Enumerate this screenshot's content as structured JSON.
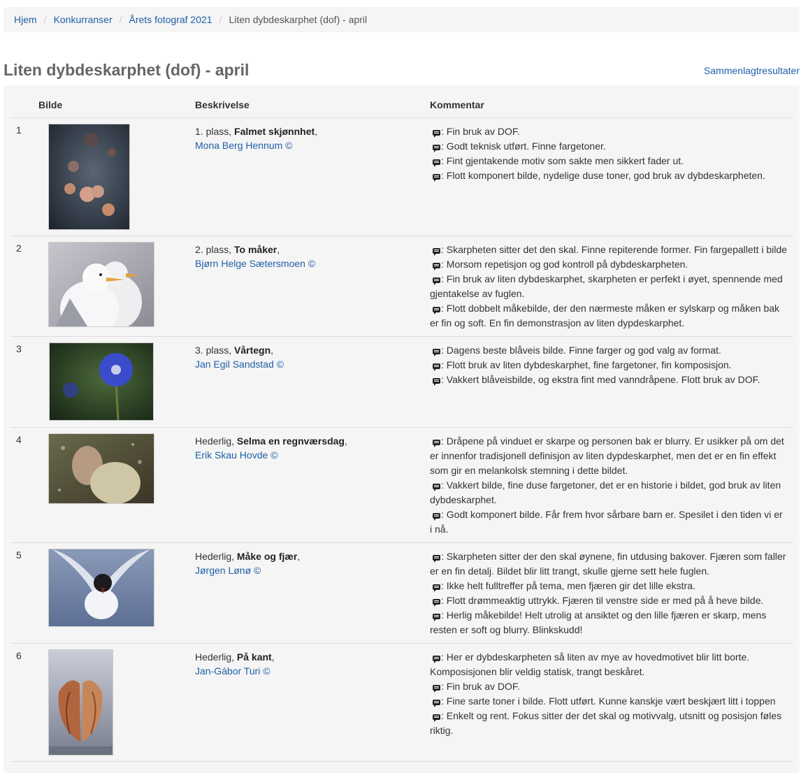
{
  "breadcrumb": {
    "items": [
      "Hjem",
      "Konkurranser",
      "Årets fotograf 2021"
    ],
    "current": "Liten dybdeskarphet (dof) - april"
  },
  "page": {
    "title": "Liten dybdeskarphet (dof) - april",
    "summary_link": "Sammenlagtresultater"
  },
  "table": {
    "headers": {
      "image": "Bilde",
      "description": "Beskrivelse",
      "comment": "Kommentar"
    },
    "rows": [
      {
        "num": "1",
        "placement": "1. plass,",
        "title": "Falmet skjønnhet",
        "author": "Mona Berg Hennum ©",
        "comments": [
          ": Fin bruk av DOF.",
          ": Godt teknisk utført. Finne fargetoner.",
          ": Fint gjentakende motiv som sakte men sikkert fader ut.",
          ": Flott komponert bilde, nydelige duse toner, god bruk av dybdeskarpheten."
        ]
      },
      {
        "num": "2",
        "placement": "2. plass,",
        "title": "To måker",
        "author": "Bjørn Helge Sætersmoen ©",
        "comments": [
          ": Skarpheten sitter det den skal. Finne repiterende former. Fin fargepallett i bilde",
          ": Morsom repetisjon og god kontroll på dybdeskarpheten.",
          ": Fin bruk av liten dybdeskarphet, skarpheten er perfekt i øyet, spennende med gjentakelse av fuglen.",
          ": Flott dobbelt måkebilde, der den nærmeste måken er sylskarp og måken bak er fin og soft. En fin demonstrasjon av liten dypdeskarphet."
        ]
      },
      {
        "num": "3",
        "placement": "3. plass,",
        "title": "Vårtegn",
        "author": "Jan Egil Sandstad ©",
        "comments": [
          ": Dagens beste blåveis bilde. Finne farger og god valg av format.",
          ": Flott bruk av liten dybdeskarphet, fine fargetoner, fin komposisjon.",
          ": Vakkert blåveisbilde, og ekstra fint med vanndråpene. Flott bruk av DOF."
        ]
      },
      {
        "num": "4",
        "placement": "Hederlig,",
        "title": "Selma en regnværsdag",
        "author": "Erik Skau Hovde ©",
        "comments": [
          ": Dråpene på vinduet er skarpe og personen bak er blurry. Er usikker på om det er innenfor tradisjonell definisjon av liten dypdeskarphet, men det er en fin effekt som gir en melankolsk stemning i dette bildet.",
          ": Vakkert bilde, fine duse fargetoner, det er en historie i bildet, god bruk av liten dybdeskarphet.",
          ": Godt komponert bilde. Får frem hvor sårbare barn er. Spesilet i den tiden vi er i nå."
        ]
      },
      {
        "num": "5",
        "placement": "Hederlig,",
        "title": "Måke og fjær",
        "author": "Jørgen Lønø ©",
        "comments": [
          ": Skarpheten sitter der den skal øynene, fin utdusing bakover. Fjæren som faller er en fin detalj. Bildet blir litt trangt, skulle gjerne sett hele fuglen.",
          ": Ikke helt fulltreffer på tema, men fjæren gir det lille ekstra.",
          ": Flott drømmeaktig uttrykk. Fjæren til venstre side er med på å heve bilde.",
          ": Herlig måkebilde! Helt utrolig at ansiktet og den lille fjæren er skarp, mens resten er soft og blurry. Blinkskudd!"
        ]
      },
      {
        "num": "6",
        "placement": "Hederlig,",
        "title": "På kant",
        "author": "Jan-Gábor Turi ©",
        "comments": [
          ": Her er dybdeskarpheten så liten av mye av hovedmotivet blir litt borte. Komposisjonen blir veldig statisk, trangt beskåret.",
          ": Fin bruk av DOF.",
          ": Fine sarte toner i bilde. Flott utført. Kunne kanskje vært beskjært litt i toppen",
          ": Enkelt og rent. Fokus sitter der det skal og motivvalg, utsnitt og posisjon føles riktig."
        ]
      }
    ]
  },
  "icons": {
    "comment": "comment-icon"
  }
}
